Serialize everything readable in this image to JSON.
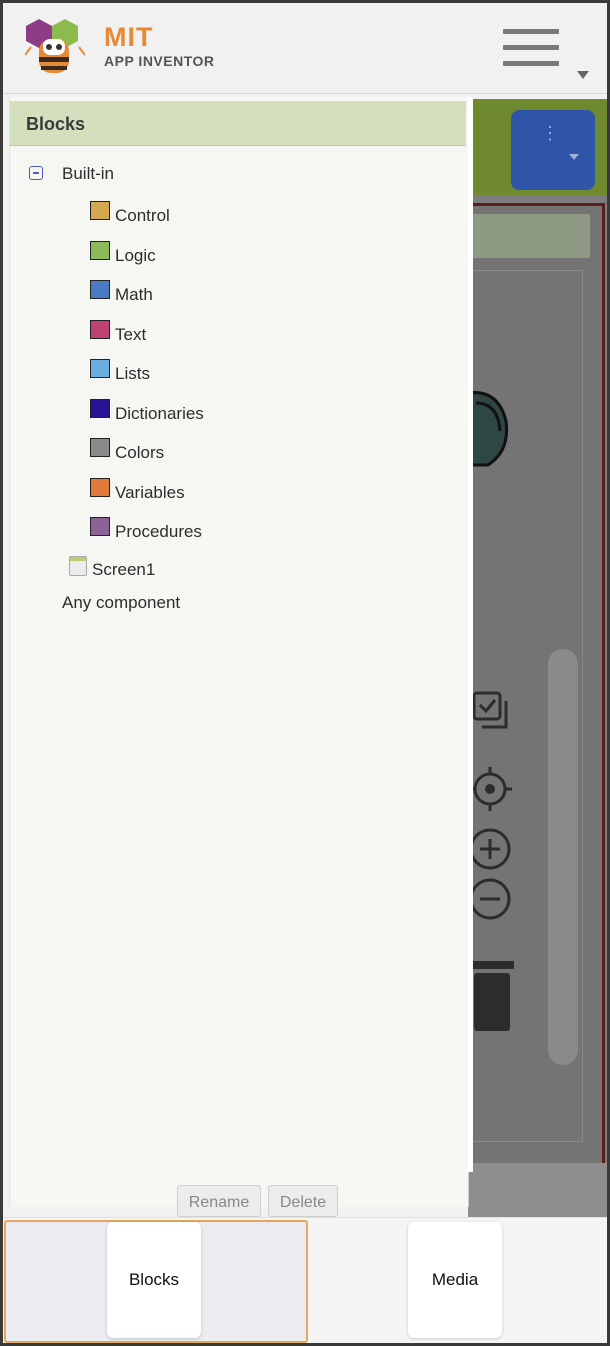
{
  "header": {
    "brand_main": "MIT",
    "brand_sub": "APP INVENTOR",
    "menu_icon": "hamburger-icon"
  },
  "drawer": {
    "title": "Blocks",
    "builtin_label": "Built-in",
    "builtin_items": [
      {
        "label": "Control",
        "color": "#d4a84f"
      },
      {
        "label": "Logic",
        "color": "#8dba58"
      },
      {
        "label": "Math",
        "color": "#4b7ac4"
      },
      {
        "label": "Text",
        "color": "#bd4270"
      },
      {
        "label": "Lists",
        "color": "#6aaedf"
      },
      {
        "label": "Dictionaries",
        "color": "#2a1496"
      },
      {
        "label": "Colors",
        "color": "#8a8a8a"
      },
      {
        "label": "Variables",
        "color": "#e0793a"
      },
      {
        "label": "Procedures",
        "color": "#8c6398"
      }
    ],
    "screen_label": "Screen1",
    "any_component_label": "Any component",
    "rename_label": "Rename",
    "delete_label": "Delete"
  },
  "tabs": {
    "blocks_label": "Blocks",
    "media_label": "Media",
    "active": "Blocks"
  },
  "colors": {
    "accent": "#e58a36",
    "drawer_header": "#d3dfbd",
    "active_tab_border": "#e1a75a"
  }
}
